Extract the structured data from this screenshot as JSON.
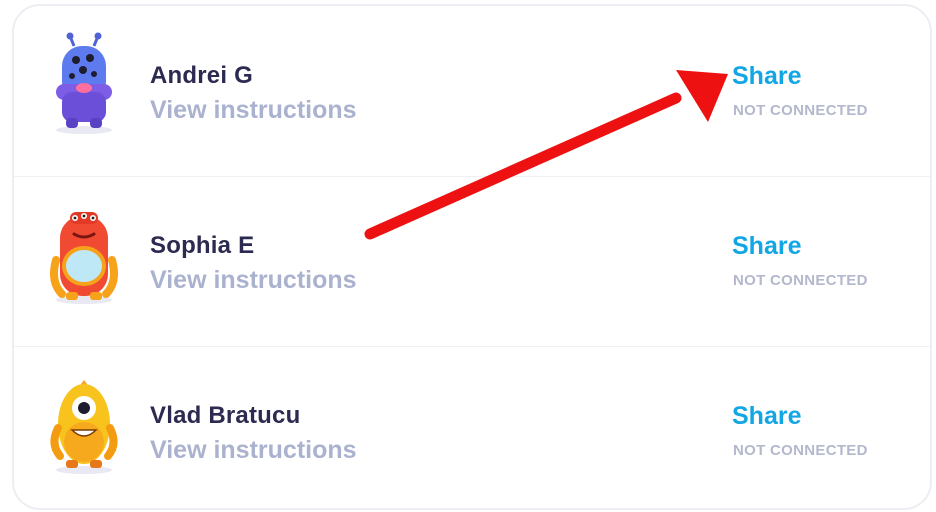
{
  "students": [
    {
      "name": "Andrei G",
      "link": "View instructions",
      "action": "Share",
      "status": "NOT CONNECTED",
      "avatar": "blue-monster-avatar"
    },
    {
      "name": "Sophia E",
      "link": "View instructions",
      "action": "Share",
      "status": "NOT CONNECTED",
      "avatar": "red-monster-avatar"
    },
    {
      "name": "Vlad Bratucu",
      "link": "View instructions",
      "action": "Share",
      "status": "NOT CONNECTED",
      "avatar": "yellow-monster-avatar"
    }
  ],
  "colors": {
    "name": "#2c2a50",
    "link": "#aab2cf",
    "share": "#12a6e4",
    "status": "#b3b8cc",
    "annotation_arrow": "#ee1111"
  }
}
